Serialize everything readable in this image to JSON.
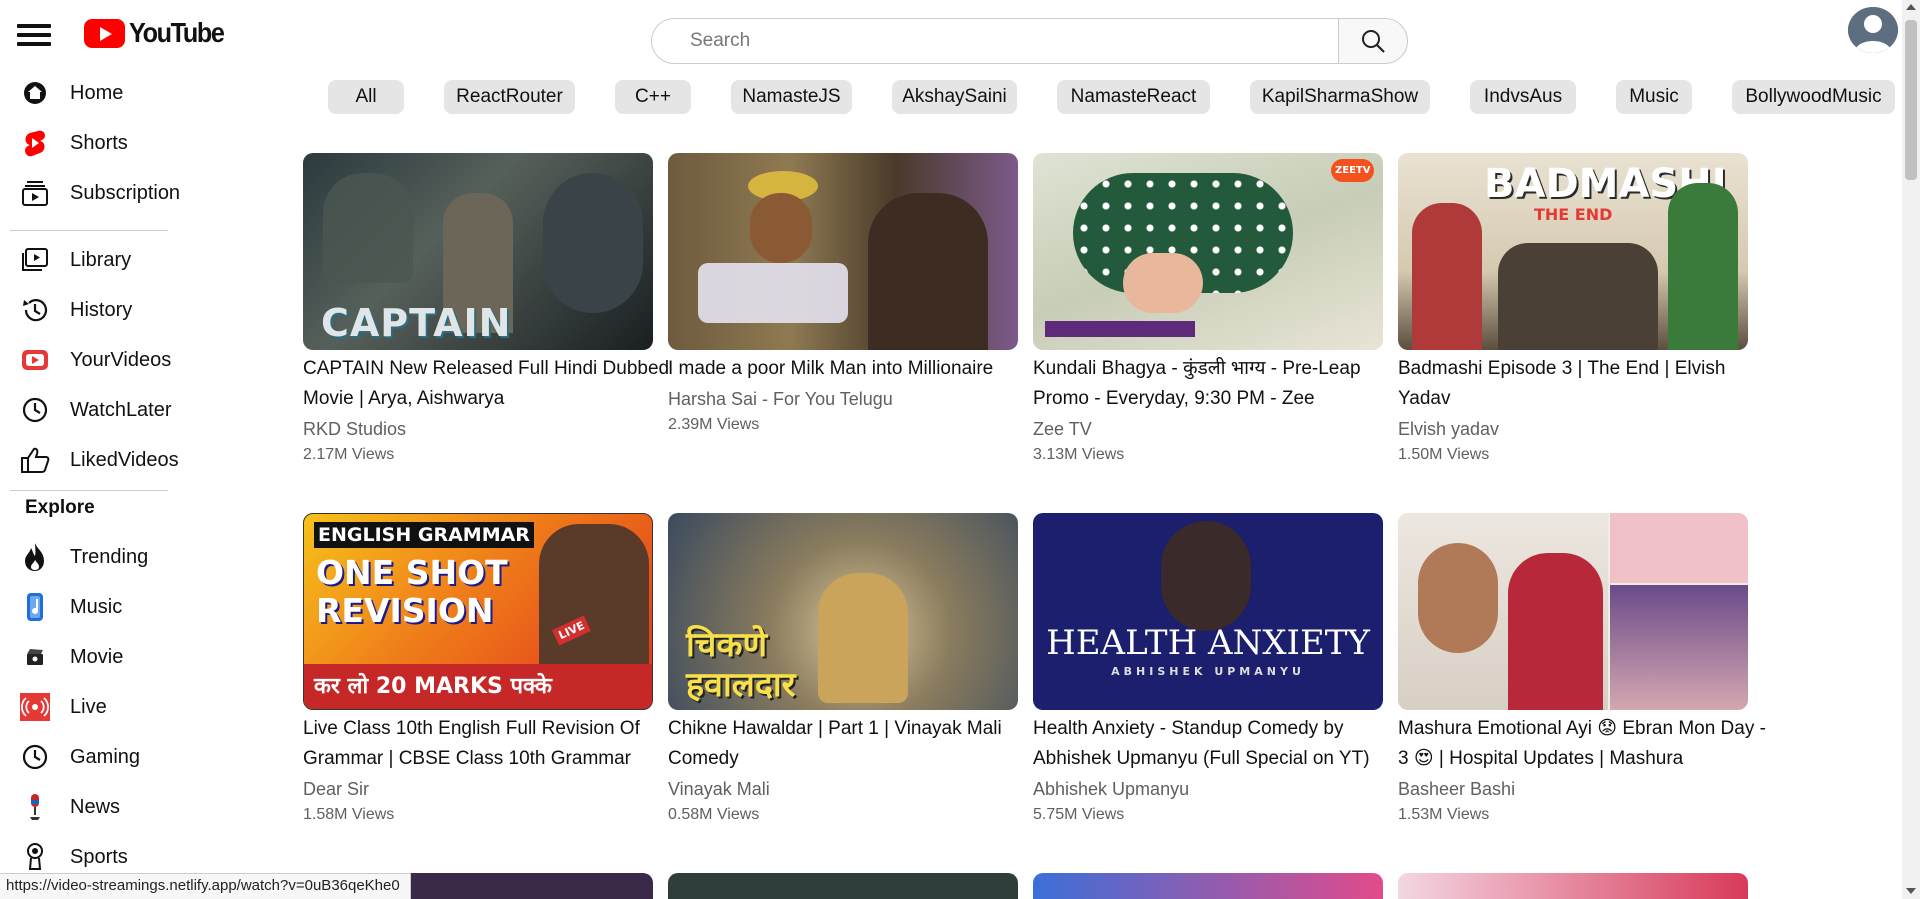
{
  "header": {
    "logo_text": "YouTube",
    "search_placeholder": "Search"
  },
  "sidebar": {
    "items_main": [
      {
        "label": "Home",
        "icon": "home-icon"
      },
      {
        "label": "Shorts",
        "icon": "shorts-icon"
      },
      {
        "label": "Subscription",
        "icon": "subscriptions-icon"
      }
    ],
    "items_library": [
      {
        "label": "Library",
        "icon": "library-icon"
      },
      {
        "label": "History",
        "icon": "history-icon"
      },
      {
        "label": "YourVideos",
        "icon": "your-videos-icon"
      },
      {
        "label": "WatchLater",
        "icon": "watch-later-icon"
      },
      {
        "label": "LikedVideos",
        "icon": "liked-videos-icon"
      }
    ],
    "explore_heading": "Explore",
    "items_explore": [
      {
        "label": "Trending",
        "icon": "trending-icon"
      },
      {
        "label": "Music",
        "icon": "music-icon"
      },
      {
        "label": "Movie",
        "icon": "movie-icon"
      },
      {
        "label": "Live",
        "icon": "live-icon"
      },
      {
        "label": "Gaming",
        "icon": "gaming-icon"
      },
      {
        "label": "News",
        "icon": "news-icon"
      },
      {
        "label": "Sports",
        "icon": "sports-icon"
      }
    ]
  },
  "chips": [
    "All",
    "ReactRouter",
    "C++",
    "NamasteJS",
    "AkshaySaini",
    "NamasteReact",
    "KapilSharmaShow",
    "IndvsAus",
    "Music",
    "BollywoodMusic"
  ],
  "videos": [
    {
      "title": "CAPTAIN New Released Full Hindi Dubbed Movie | Arya, Aishwarya",
      "channel": "RKD Studios",
      "views": "2.17M Views",
      "thumb_text": "CAPTAIN"
    },
    {
      "title": "I made a poor Milk Man into Millionaire",
      "channel": "Harsha Sai - For You Telugu",
      "views": "2.39M Views",
      "thumb_text": ""
    },
    {
      "title": "Kundali Bhagya - कुंडली भाग्य - Pre-Leap Promo - Everyday, 9:30 PM - Zee",
      "channel": "Zee TV",
      "views": "3.13M Views",
      "thumb_text": "ZEETV"
    },
    {
      "title": "Badmashi Episode 3 | The End | Elvish Yadav",
      "channel": "Elvish yadav",
      "views": "1.50M Views",
      "thumb_text": "BADMASHI"
    },
    {
      "title": "Live Class 10th English Full Revision Of Grammar | CBSE Class 10th Grammar",
      "channel": "Dear Sir",
      "views": "1.58M Views",
      "thumb_text": "ONE SHOT REVISION"
    },
    {
      "title": "Chikne Hawaldar | Part 1 |  Vinayak Mali Comedy",
      "channel": "Vinayak Mali",
      "views": "0.58M Views",
      "thumb_text": "चिकणे हवालदार"
    },
    {
      "title": "Health Anxiety - Standup Comedy by Abhishek Upmanyu (Full Special on YT)",
      "channel": "Abhishek Upmanyu",
      "views": "5.75M Views",
      "thumb_text": "HEALTH ANXIETY"
    },
    {
      "title": "Mashura Emotional Ayi 😟 Ebran Mon Day - 3 😍 | Hospital Updates | Mashura",
      "channel": "Basheer Bashi",
      "views": "1.53M Views",
      "thumb_text": ""
    }
  ],
  "thumb_sub_texts": {
    "english_grammar": "ENGLISH GRAMMAR",
    "marks": "कर लो 20 MARKS पक्के",
    "live": "LIVE",
    "health_sub": "ABHISHEK UPMANYU",
    "the_end": "THE END"
  },
  "status_bar_url": "https://video-streamings.netlify.app/watch?v=0uB36qeKhe0",
  "colors": {
    "brand_red": "#ff0000",
    "chip_bg": "#e5e5e5",
    "secondary_text": "#606060"
  }
}
